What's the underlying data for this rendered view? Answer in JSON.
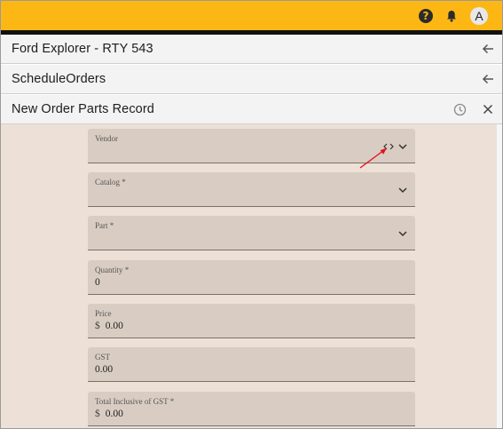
{
  "appbar": {
    "help_icon": "help-circle-icon",
    "bell_icon": "bell-icon",
    "avatar_initial": "A",
    "accent": "#fdb714"
  },
  "breadcrumbs": [
    {
      "label": "Ford Explorer - RTY 543",
      "action_icon": "arrow-left-icon"
    },
    {
      "label": "ScheduleOrders",
      "action_icon": "arrow-left-icon"
    },
    {
      "label": "New Order Parts Record",
      "action_icons": [
        "history-clock-icon",
        "close-icon"
      ]
    }
  ],
  "form": {
    "vendor": {
      "label": "Vendor",
      "value": "",
      "icons": [
        "code-icon",
        "chevron-down-icon"
      ]
    },
    "catalog": {
      "label": "Catalog *",
      "value": ""
    },
    "part": {
      "label": "Part *",
      "value": ""
    },
    "quantity": {
      "label": "Quantity *",
      "value": "0"
    },
    "price": {
      "label": "Price",
      "currency": "$",
      "value": "0.00"
    },
    "gst": {
      "label": "GST",
      "value": "0.00"
    },
    "total": {
      "label": "Total Inclusive of GST *",
      "currency": "$",
      "value": "0.00"
    }
  },
  "annotation": {
    "color": "#e0141e"
  }
}
